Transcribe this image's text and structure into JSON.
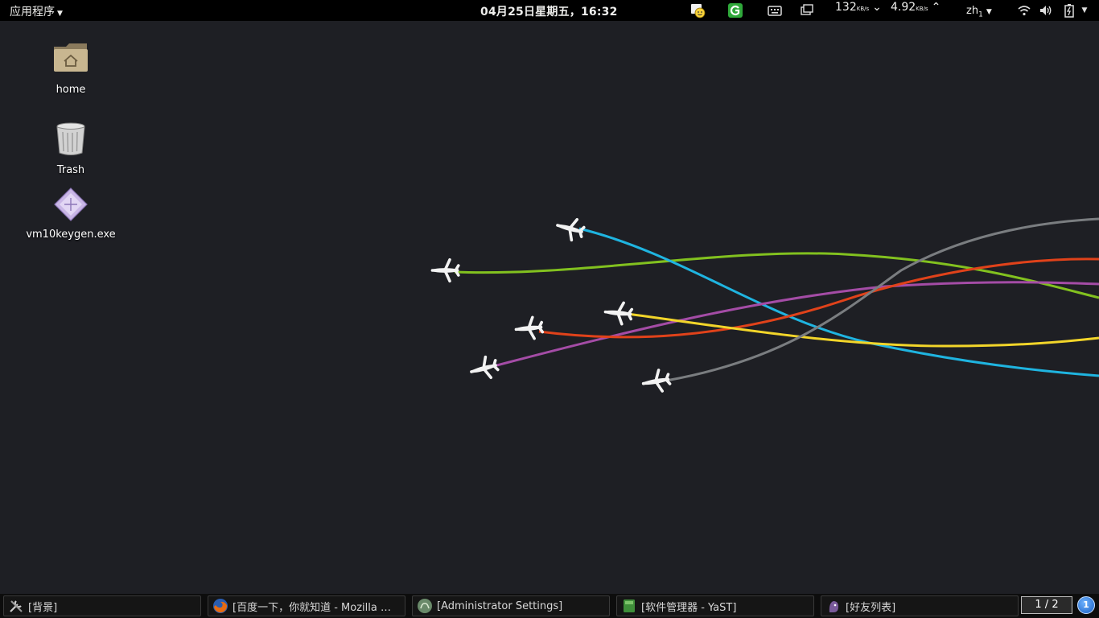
{
  "topbar": {
    "applications_label": "应用程序",
    "clock": "04月25日星期五，16:32",
    "net_down_value": "132",
    "net_down_unit": "KB/s",
    "net_up_value": "4.92",
    "net_up_unit": "KB/s",
    "input_method": "zh",
    "input_method_sub": "1",
    "icons": [
      "chat-notification-icon",
      "green-g-app-icon",
      "keyboard-icon",
      "window-switcher-icon",
      "wifi-icon",
      "volume-icon",
      "battery-icon"
    ]
  },
  "desktop": {
    "icons": [
      {
        "label": "home",
        "icon": "folder-home-icon"
      },
      {
        "label": "Trash",
        "icon": "trash-icon"
      },
      {
        "label": "vm10keygen.exe",
        "icon": "exe-file-icon"
      }
    ],
    "wallpaper_colors": [
      "#82c11f",
      "#1fb4e0",
      "#a44ca6",
      "#e0421a",
      "#f2d52a",
      "#7a7d80"
    ]
  },
  "taskbar": {
    "tasks": [
      {
        "label": "[背景]",
        "icon": "tools-icon"
      },
      {
        "label": "[百度一下，你就知道 - Mozilla …",
        "icon": "firefox-icon"
      },
      {
        "label": "[Administrator Settings]",
        "icon": "settings-icon"
      },
      {
        "label": "[软件管理器 - YaST]",
        "icon": "yast-icon"
      },
      {
        "label": "[好友列表]",
        "icon": "pidgin-icon"
      }
    ],
    "pager": "1 / 2",
    "notification_count": "1"
  }
}
